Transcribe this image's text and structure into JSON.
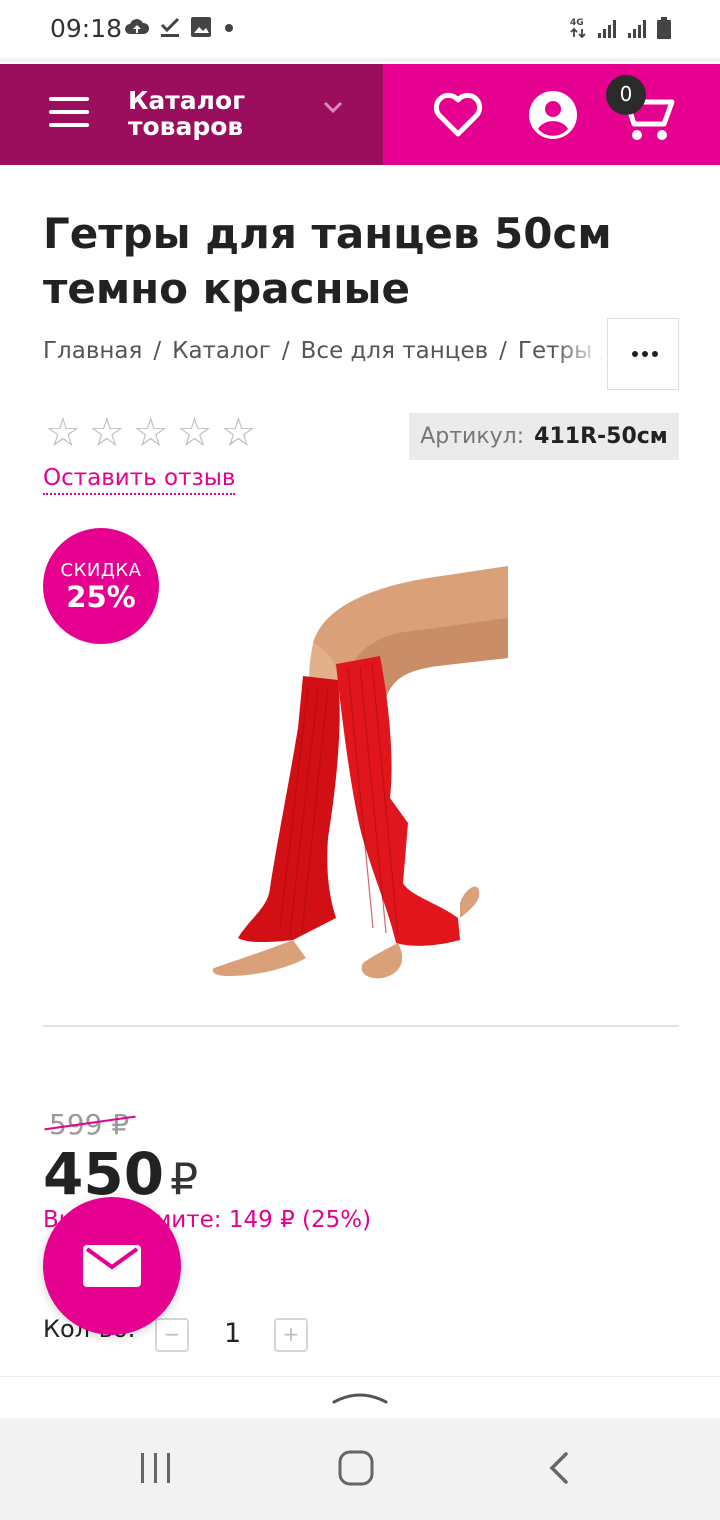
{
  "status_bar": {
    "time": "09:18",
    "left_icons": [
      "cloud-upload-icon",
      "download-done-icon",
      "image-icon",
      "dot-icon"
    ],
    "network": "4G",
    "right_icons": [
      "network-4g-icon",
      "signal-icon",
      "signal-icon",
      "battery-icon"
    ]
  },
  "header": {
    "catalog_label": "Каталог товаров",
    "cart_count": "0",
    "colors": {
      "catalog_bg": "#9b0e5e",
      "accent": "#e6008f"
    }
  },
  "product": {
    "title": "Гетры для танцев 50см темно красные",
    "breadcrumbs": [
      "Главная",
      "Каталог",
      "Все для танцев",
      "Гетры д"
    ],
    "rating_stars": 5,
    "rating_value": 0,
    "review_link": "Оставить отзыв",
    "sku_label": "Артикул:",
    "sku_value": "411R-50см",
    "discount_label": "СКИДКА",
    "discount_value": "25%",
    "image_alt": "Красные гетры на ногах"
  },
  "pricing": {
    "old_price": "599 ₽",
    "new_price": "450",
    "currency": "₽",
    "save_text": "Вы экономите: 149 ₽ (25%)"
  },
  "quantity": {
    "label": "Кол-во:",
    "value": "1",
    "minus": "−",
    "plus": "+"
  }
}
